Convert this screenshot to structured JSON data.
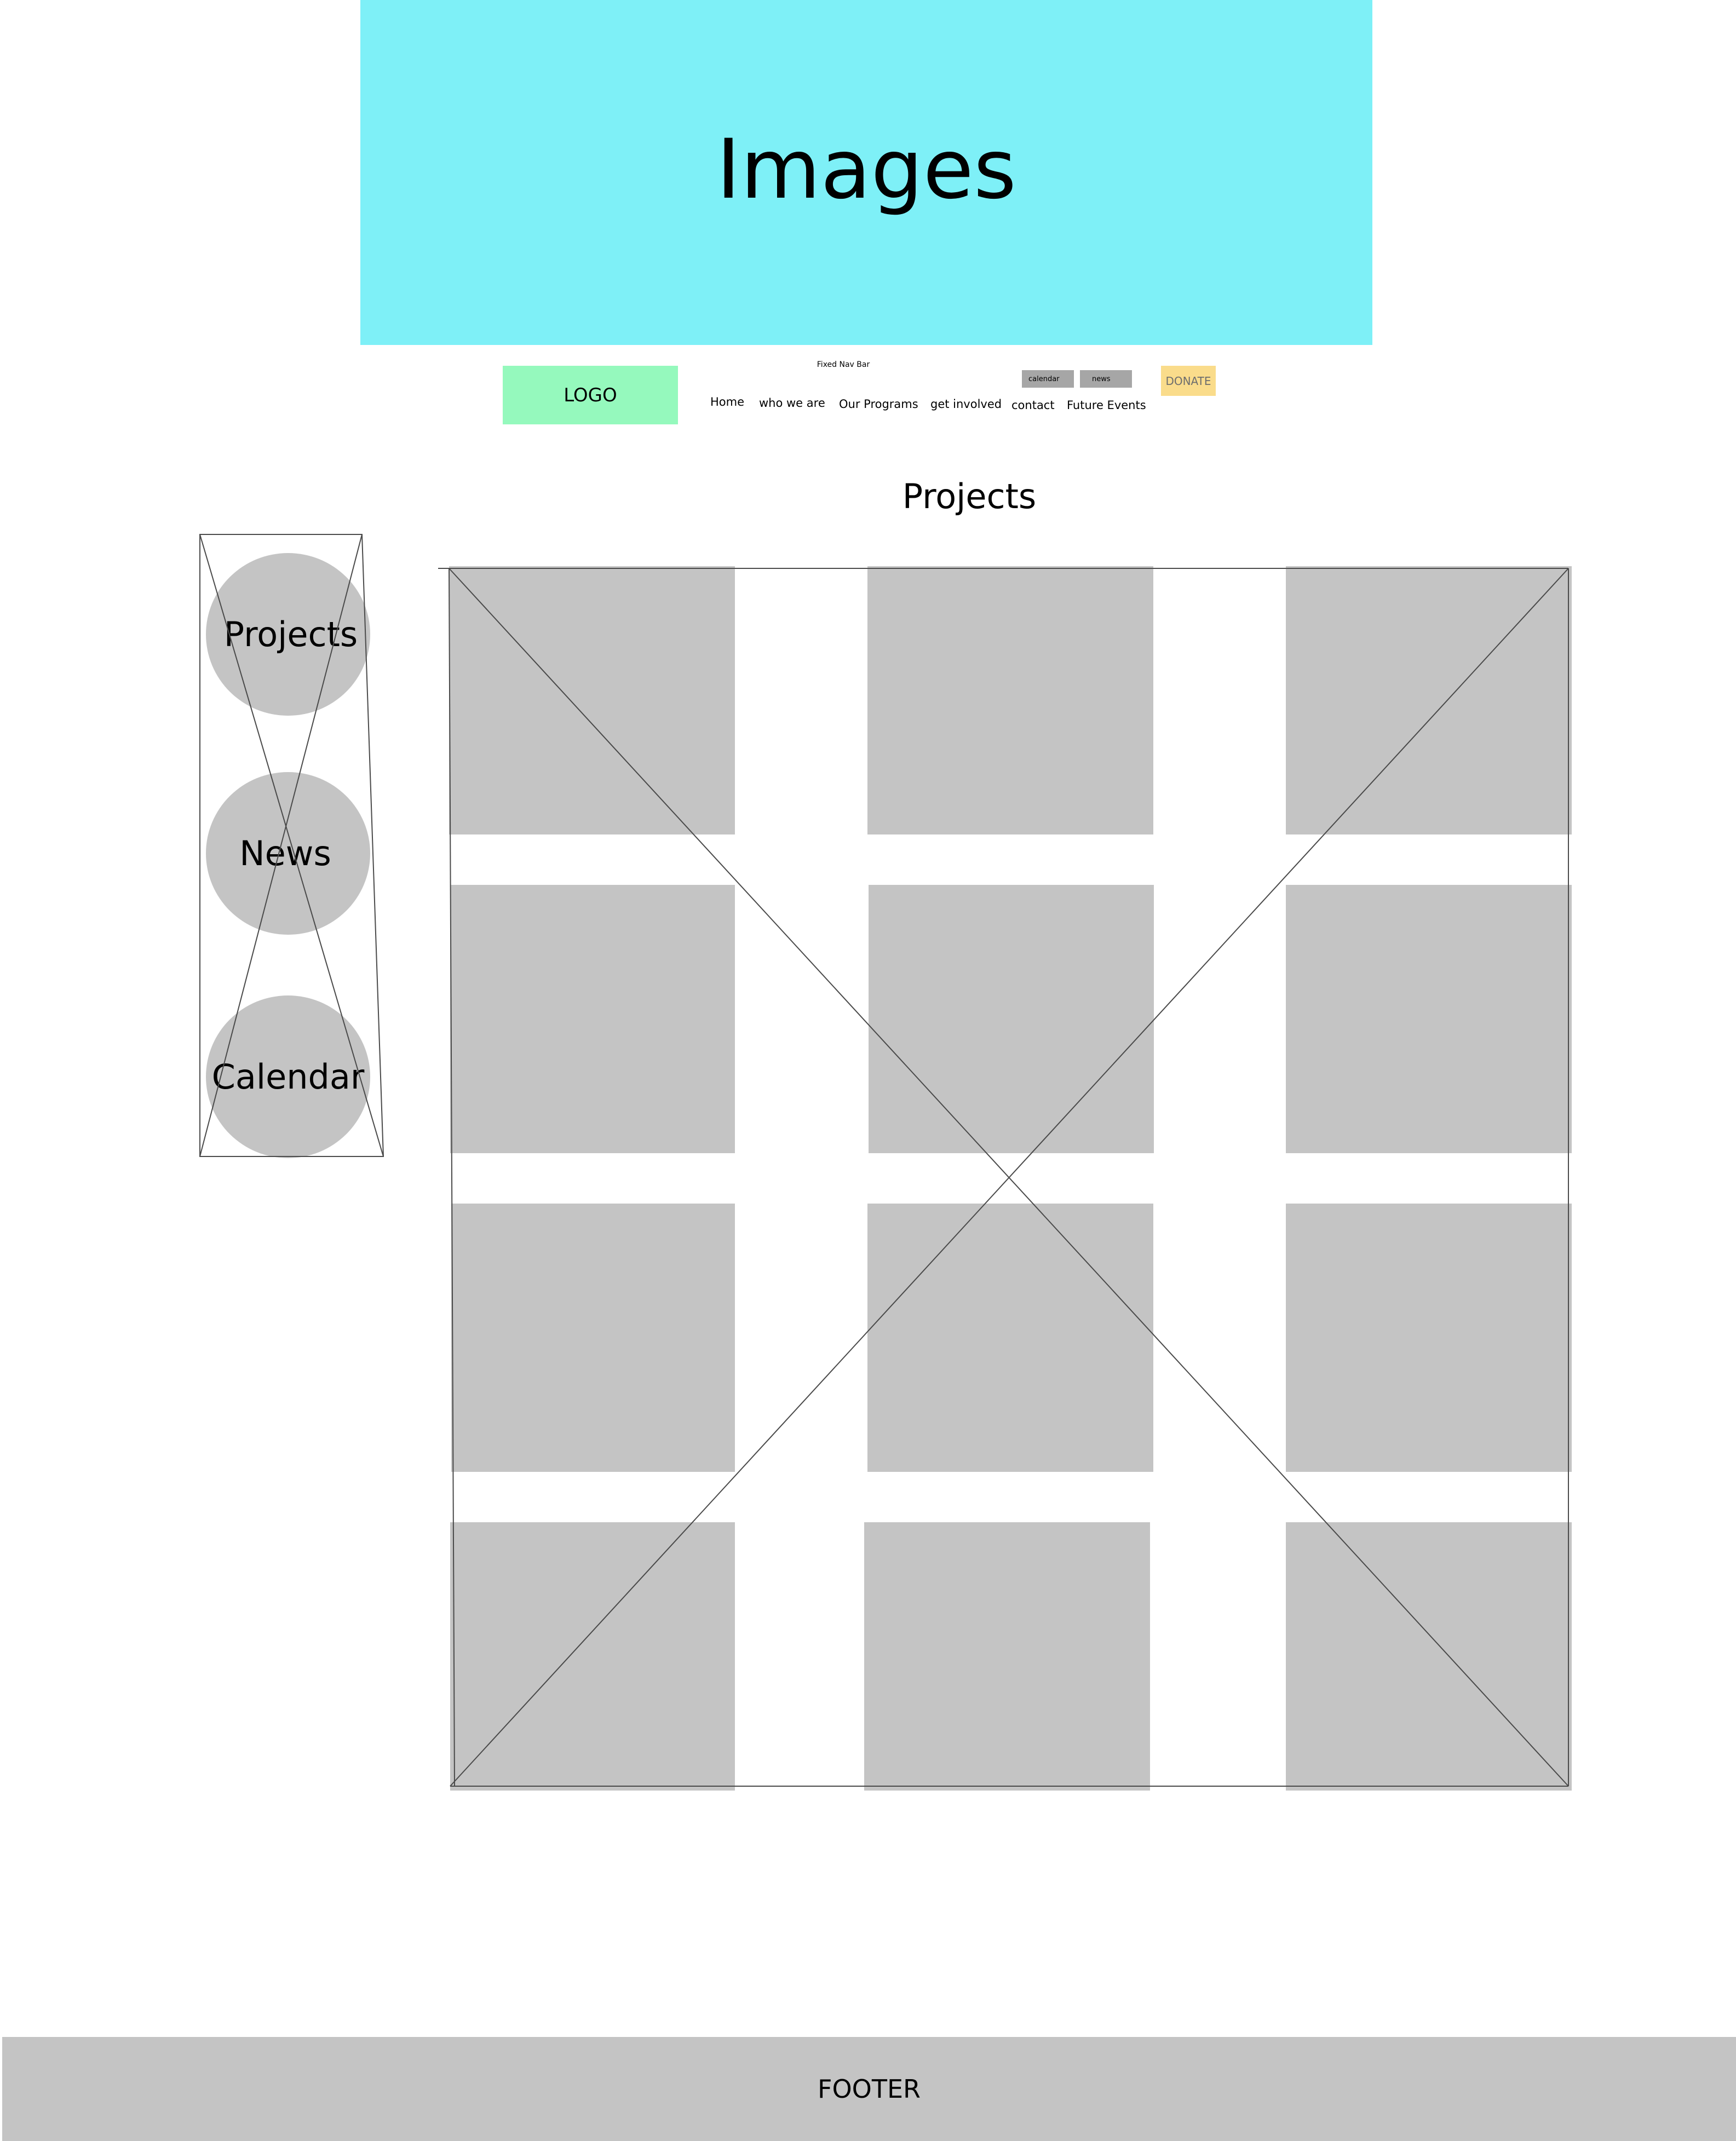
{
  "hero": {
    "title": "Images",
    "color": "#7ef0f7"
  },
  "nav": {
    "caption": "Fixed Nav Bar",
    "logo": "LOGO",
    "links": [
      {
        "label": "Home"
      },
      {
        "label": "who we are"
      },
      {
        "label": "Our Programs"
      },
      {
        "label": "get involved"
      },
      {
        "label": "contact"
      },
      {
        "label": "Future Events"
      }
    ],
    "mini_buttons": [
      {
        "label": "calendar"
      },
      {
        "label": "news"
      }
    ],
    "donate": "DONATE",
    "logo_color": "#95f9bd",
    "donate_color": "#fadc8b"
  },
  "main": {
    "heading": "Projects",
    "side_circles": [
      {
        "label": "Projects"
      },
      {
        "label": "News"
      },
      {
        "label": "Calendar"
      }
    ],
    "grid": {
      "rows": 4,
      "columns": 3,
      "tile_color": "#c4c4c4"
    }
  },
  "footer": {
    "label": "FOOTER"
  }
}
